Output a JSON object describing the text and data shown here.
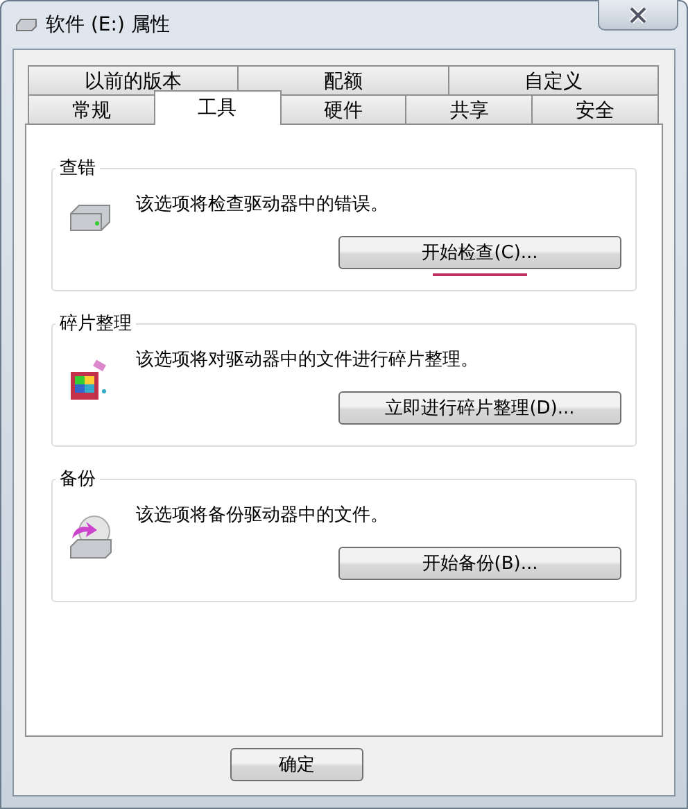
{
  "window": {
    "title": "软件 (E:) 属性"
  },
  "tab_rows": [
    [
      {
        "label": "以前的版本",
        "selected": false
      },
      {
        "label": "配额",
        "selected": false
      },
      {
        "label": "自定义",
        "selected": false
      }
    ],
    [
      {
        "label": "常规",
        "selected": false
      },
      {
        "label": "工具",
        "selected": true
      },
      {
        "label": "硬件",
        "selected": false
      },
      {
        "label": "共享",
        "selected": false
      },
      {
        "label": "安全",
        "selected": false
      }
    ]
  ],
  "sections": [
    {
      "kind": "check",
      "title": "查错",
      "description": "该选项将检查驱动器中的错误。",
      "button": "开始检查(C)...",
      "underlined": true
    },
    {
      "kind": "defrag",
      "title": "碎片整理",
      "description": "该选项将对驱动器中的文件进行碎片整理。",
      "button": "立即进行碎片整理(D)...",
      "underlined": false
    },
    {
      "kind": "backup",
      "title": "备份",
      "description": "该选项将备份驱动器中的文件。",
      "button": "开始备份(B)...",
      "underlined": false
    }
  ],
  "buttons": [
    "确定"
  ]
}
